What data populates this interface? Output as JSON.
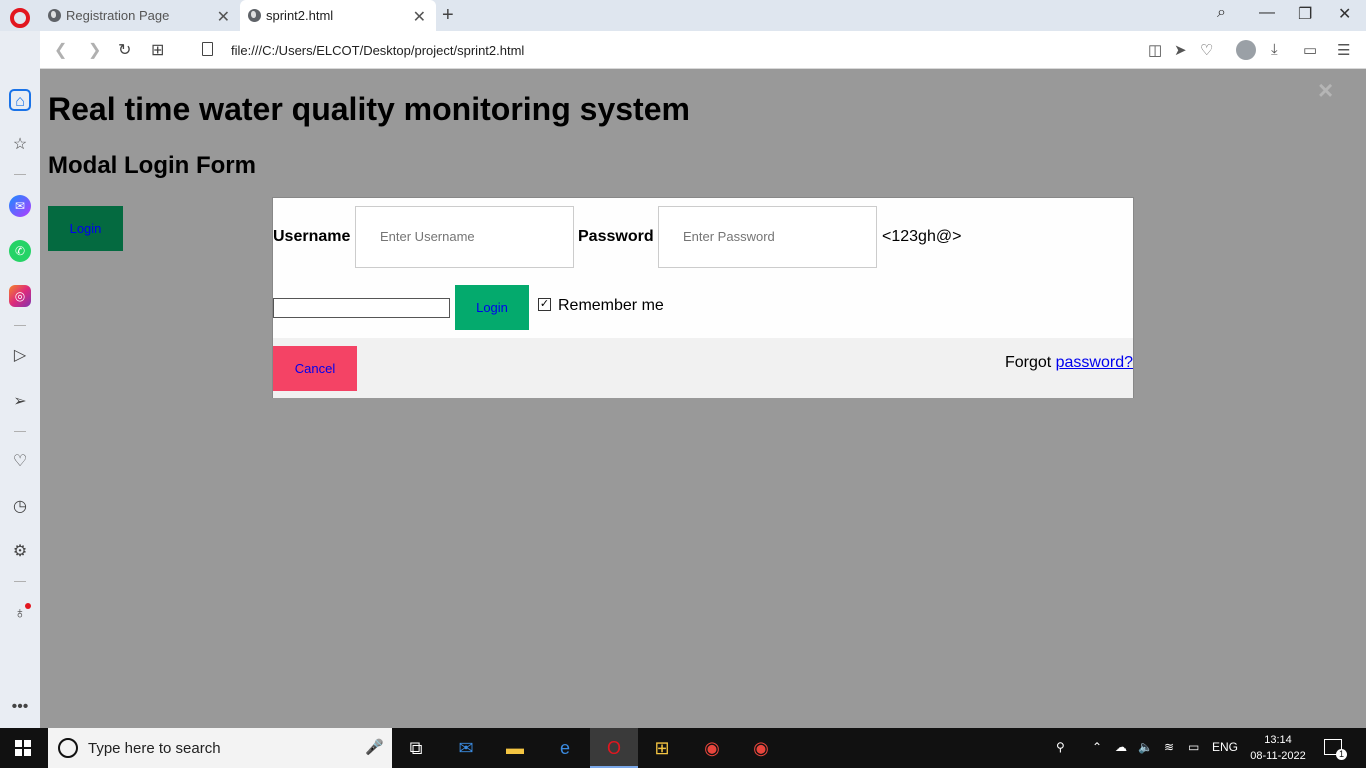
{
  "browser": {
    "tabs": [
      {
        "label": "Registration Page"
      },
      {
        "label": "sprint2.html"
      }
    ],
    "url": "file:///C:/Users/ELCOT/Desktop/project/sprint2.html"
  },
  "page": {
    "title": "Real time water quality monitoring system",
    "subtitle": "Modal Login Form",
    "open_login_label": "Login",
    "close_symbol": "×"
  },
  "modal": {
    "username_label": "Username",
    "username_placeholder": "Enter Username",
    "password_label": "Password",
    "password_placeholder": "Enter Password",
    "password_hint": "<123gh@>",
    "login_label": "Login",
    "remember_label": "Remember me",
    "remember_checked": true,
    "cancel_label": "Cancel",
    "forgot_text": "Forgot ",
    "forgot_link": "password?"
  },
  "taskbar": {
    "search_placeholder": "Type here to search",
    "language": "ENG",
    "time": "13:14",
    "date": "08-11-2022",
    "notification_count": "1"
  },
  "colors": {
    "overlay": "#999999",
    "open_login_bg": "#046a40",
    "login_bg": "#04aa6d",
    "cancel_bg": "#f44365",
    "link": "#0000ee"
  }
}
